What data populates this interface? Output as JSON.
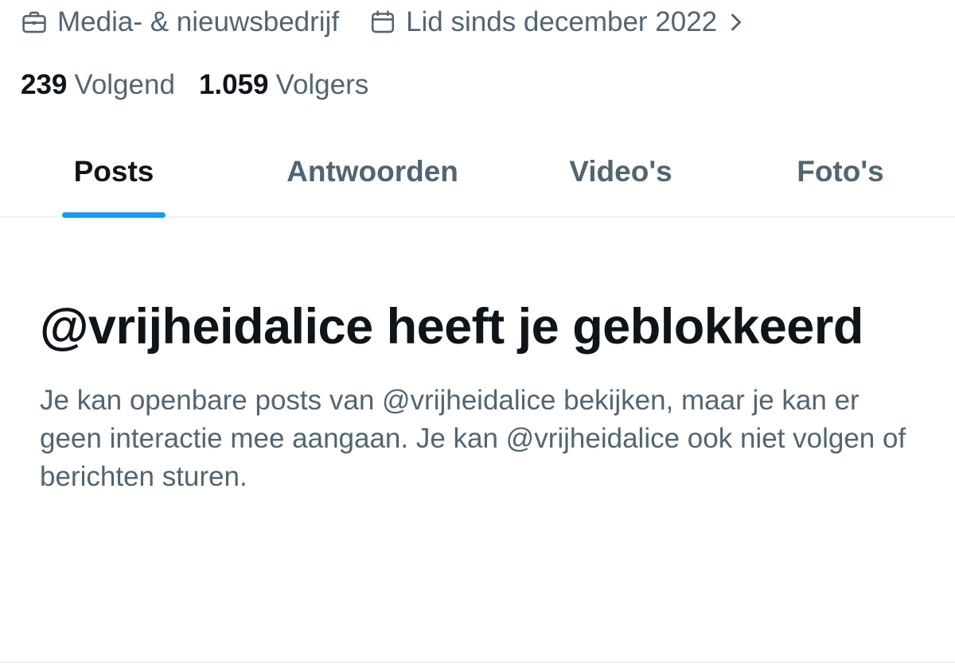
{
  "profile": {
    "category": "Media- & nieuwsbedrijf",
    "joined": "Lid sinds december 2022",
    "following_count": "239",
    "following_label": "Volgend",
    "followers_count": "1.059",
    "followers_label": "Volgers"
  },
  "tabs": [
    {
      "label": "Posts",
      "active": true
    },
    {
      "label": "Antwoorden",
      "active": false
    },
    {
      "label": "Video's",
      "active": false
    },
    {
      "label": "Foto's",
      "active": false
    }
  ],
  "blocked_notice": {
    "title": "@vrijheidalice heeft je geblokkeerd",
    "body": "Je kan openbare posts van @vrijheidalice bekijken, maar je kan er geen interactie mee aangaan. Je kan @vrijheidalice ook niet volgen of berichten sturen."
  },
  "colors": {
    "accent": "#1d9bf0",
    "text_primary": "#0f1419",
    "text_secondary": "#536471",
    "divider": "#eff3f4"
  },
  "icons": {
    "category": "briefcase-icon",
    "joined": "calendar-icon",
    "expand": "chevron-right-icon"
  }
}
